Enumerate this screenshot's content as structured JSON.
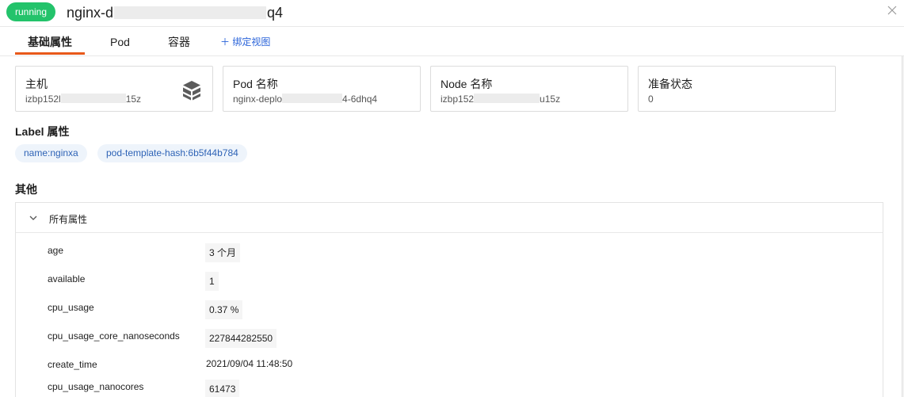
{
  "header": {
    "status": "running",
    "title_start": "nginx-d",
    "title_end": "q4",
    "close_icon": "close-icon"
  },
  "colors": {
    "status_green": "#23c36b",
    "tab_accent": "#e8591a",
    "link_blue": "#2a63d9",
    "tag_bg": "#eef4fb",
    "tag_text": "#2e63b6"
  },
  "tabs": [
    {
      "label": "基础属性",
      "active": true
    },
    {
      "label": "Pod",
      "active": false
    },
    {
      "label": "容器",
      "active": false
    }
  ],
  "bind_view": {
    "icon": "plus-icon",
    "label": "＋ 绑定视图"
  },
  "cards": {
    "host": {
      "label": "主机",
      "value_start": "izbp152l",
      "value_end": "15z",
      "icon": "server-cube-icon"
    },
    "pod": {
      "label": "Pod 名称",
      "value_start": "nginx-deplo",
      "value_end": "4-6dhq4"
    },
    "node": {
      "label": "Node 名称",
      "value_start": "izbp152",
      "value_end": "u15z"
    },
    "ready": {
      "label": "准备状态",
      "value": "0"
    }
  },
  "labels_section": {
    "title": "Label 属性",
    "tags": [
      "name:nginxa",
      "pod-template-hash:6b5f44b784"
    ]
  },
  "other_section": {
    "title": "其他",
    "panel_title": "所有属性",
    "panel_icon": "chevron-down-icon",
    "properties": [
      {
        "key": "age",
        "value": "3 个月"
      },
      {
        "key": "available",
        "value": "1"
      },
      {
        "key": "cpu_usage",
        "value": "0.37 %"
      },
      {
        "key": "cpu_usage_core_nanoseconds",
        "value": "227844282550"
      },
      {
        "key": "create_time",
        "value": "2021/09/04 11:48:50"
      },
      {
        "key": "cpu_usage_nanocores",
        "value": "61473"
      }
    ]
  }
}
